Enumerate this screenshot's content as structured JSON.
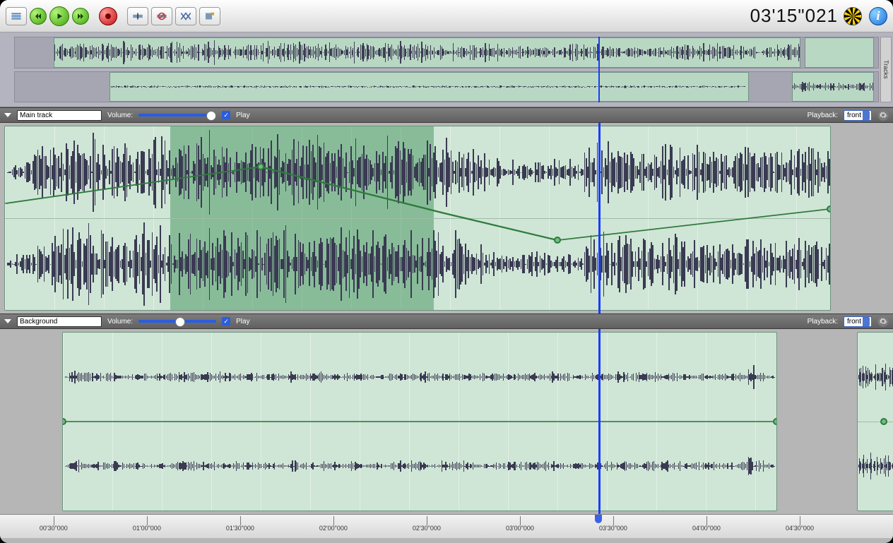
{
  "toolbar": {
    "timecode": "03'15\"021",
    "buttons": {
      "selection_tool": "selection-tool",
      "rewind": "rewind",
      "play": "play",
      "fastforward": "fast-forward",
      "record": "record",
      "cut": "clip-cut",
      "silence": "clip-silence",
      "fade": "clip-fade",
      "marker": "marker-tool"
    }
  },
  "sidetab_label": "Tracks",
  "tracks": {
    "main": {
      "name": "Main track",
      "volume_label": "Volume:",
      "play_label": "Play",
      "play_checked": true,
      "volume_percent": 100,
      "playback_label": "Playback:",
      "playback_value": "front"
    },
    "background": {
      "name": "Background",
      "volume_label": "Volume:",
      "play_label": "Play",
      "play_checked": true,
      "volume_percent": 60,
      "playback_label": "Playback:",
      "playback_value": "front"
    }
  },
  "ruler_labels": [
    "00'30\"000",
    "01'00\"000",
    "01'30\"000",
    "02'00\"000",
    "02'30\"000",
    "03'00\"000",
    "03'30\"000",
    "04'00\"000",
    "04'30\"000"
  ],
  "colors": {
    "waveform": "#3a3a52",
    "clip_bg": "#cfe5d6",
    "selection": "#4f9b68",
    "playhead": "#1a3cff",
    "envelope": "#2e7a3c"
  },
  "playhead_percent": 67
}
